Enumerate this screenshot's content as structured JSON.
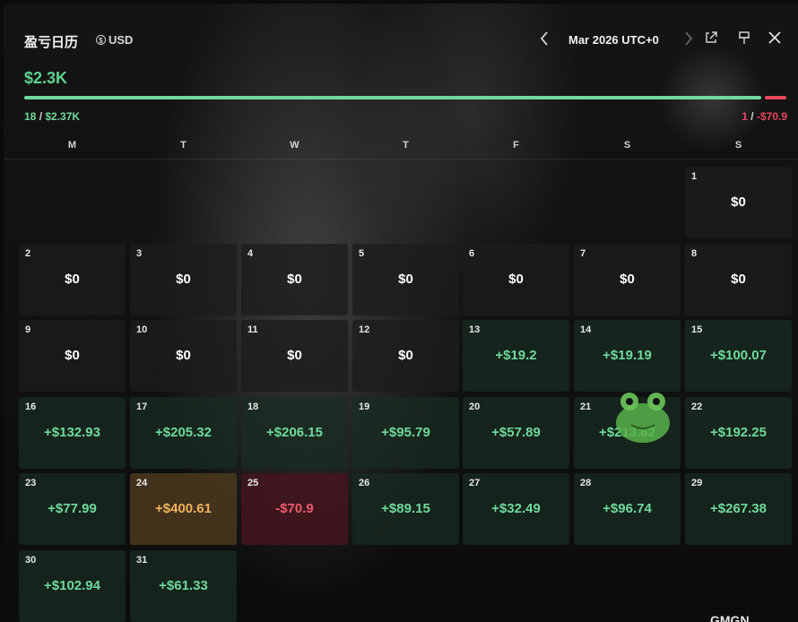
{
  "header": {
    "title": "盈亏日历",
    "currency": "USD",
    "month": "Mar 2026 UTC+0",
    "icons": [
      "chevron-left-icon",
      "chevron-right-icon",
      "external-link-icon",
      "pin-icon",
      "close-icon"
    ]
  },
  "summary": {
    "total": "$2.3K",
    "win_count": "18",
    "win_amount": "$2.37K",
    "loss_count": "1",
    "loss_amount": "-$70.9",
    "win_color": "#6fd99c",
    "loss_color": "#e5485f",
    "win_fraction": 0.97
  },
  "weekdays": [
    "M",
    "T",
    "W",
    "T",
    "F",
    "S",
    "S"
  ],
  "days": [
    {
      "day": "1",
      "value": "$0",
      "type": "zero"
    },
    {
      "day": "2",
      "value": "$0",
      "type": "zero"
    },
    {
      "day": "3",
      "value": "$0",
      "type": "zero"
    },
    {
      "day": "4",
      "value": "$0",
      "type": "zero"
    },
    {
      "day": "5",
      "value": "$0",
      "type": "zero"
    },
    {
      "day": "6",
      "value": "$0",
      "type": "zero"
    },
    {
      "day": "7",
      "value": "$0",
      "type": "zero"
    },
    {
      "day": "8",
      "value": "$0",
      "type": "zero"
    },
    {
      "day": "9",
      "value": "$0",
      "type": "zero"
    },
    {
      "day": "10",
      "value": "$0",
      "type": "zero"
    },
    {
      "day": "11",
      "value": "$0",
      "type": "zero"
    },
    {
      "day": "12",
      "value": "$0",
      "type": "zero"
    },
    {
      "day": "13",
      "value": "+$19.2",
      "type": "pos"
    },
    {
      "day": "14",
      "value": "+$19.19",
      "type": "pos"
    },
    {
      "day": "15",
      "value": "+$100.07",
      "type": "pos"
    },
    {
      "day": "16",
      "value": "+$132.93",
      "type": "pos"
    },
    {
      "day": "17",
      "value": "+$205.32",
      "type": "pos"
    },
    {
      "day": "18",
      "value": "+$206.15",
      "type": "pos"
    },
    {
      "day": "19",
      "value": "+$95.79",
      "type": "pos"
    },
    {
      "day": "20",
      "value": "+$57.89",
      "type": "pos"
    },
    {
      "day": "21",
      "value": "+$213.62",
      "type": "pos"
    },
    {
      "day": "22",
      "value": "+$192.25",
      "type": "pos"
    },
    {
      "day": "23",
      "value": "+$77.99",
      "type": "pos"
    },
    {
      "day": "24",
      "value": "+$400.61",
      "type": "max"
    },
    {
      "day": "25",
      "value": "-$70.9",
      "type": "neg"
    },
    {
      "day": "26",
      "value": "+$89.15",
      "type": "pos"
    },
    {
      "day": "27",
      "value": "+$32.49",
      "type": "pos"
    },
    {
      "day": "28",
      "value": "+$96.74",
      "type": "pos"
    },
    {
      "day": "29",
      "value": "+$267.38",
      "type": "pos"
    },
    {
      "day": "30",
      "value": "+$102.94",
      "type": "pos"
    },
    {
      "day": "31",
      "value": "+$61.33",
      "type": "pos"
    }
  ],
  "brand": "GMGN"
}
